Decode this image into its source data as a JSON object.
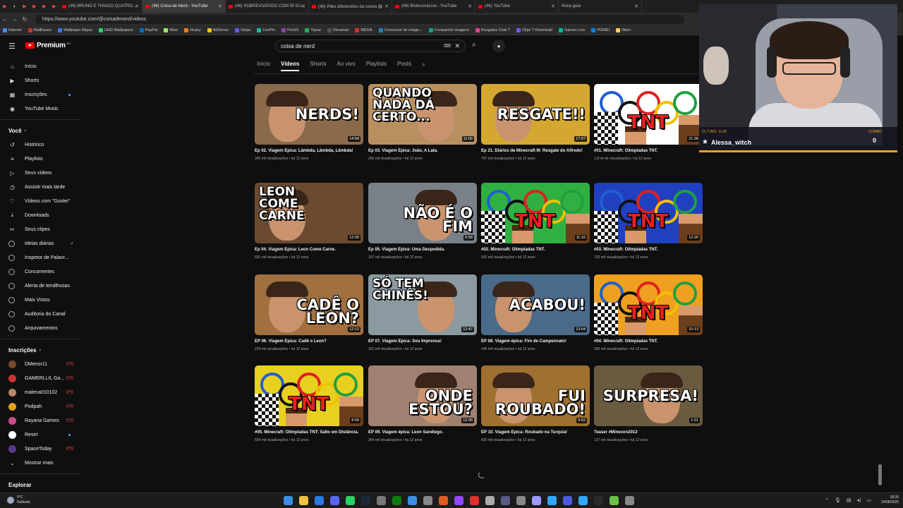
{
  "browser": {
    "tabs": [
      {
        "label": "(46) BRUNO E THIAGO QUATRO...",
        "active": false
      },
      {
        "label": "(46) Coisa de Nerd - YouTube",
        "active": true
      },
      {
        "label": "(46) SOBREVIVENDO COM 50 EU...",
        "active": false
      },
      {
        "label": "(46) Piles diferentões da coreia 😱",
        "active": false
      },
      {
        "label": "(46) BisteconeLive - YouTube",
        "active": false
      },
      {
        "label": "(46) YouTube",
        "active": false
      },
      {
        "label": "Nova guia",
        "active": false
      }
    ],
    "url": "https://www.youtube.com/@coisadenerd/videos",
    "bookmarks": [
      "Internet",
      "Wallhaven",
      "Wallpaper Abyss",
      "UHD Wallpapers",
      "PayPal",
      "Wise",
      "Husky",
      "AdSense",
      "Stripe",
      "LivePix",
      "PixGG",
      "Tipsai",
      "Streamar",
      "MEGA",
      "Conversor de image...",
      "Compactar imagens",
      "Resgates Chat T",
      "Clips T Download",
      "Games Live",
      "PGMEI",
      "Warn"
    ]
  },
  "masthead": {
    "logo_text": "Premium",
    "logo_region": "BR",
    "search_value": "coisa de nerd"
  },
  "channel_tabs": [
    "Início",
    "Vídeos",
    "Shorts",
    "Ao vivo",
    "Playlists",
    "Posts"
  ],
  "sidebar": {
    "main": [
      {
        "label": "Início",
        "icon": "home"
      },
      {
        "label": "Shorts",
        "icon": "shorts"
      },
      {
        "label": "Inscrições",
        "icon": "subscriptions",
        "dot": true
      },
      {
        "label": "YouTube Music",
        "icon": "music"
      }
    ],
    "you_heading": "Você",
    "you_items": [
      {
        "label": "Histórico",
        "icon": "history"
      },
      {
        "label": "Playlists",
        "icon": "playlists"
      },
      {
        "label": "Seus vídeos",
        "icon": "your-videos"
      },
      {
        "label": "Assistir mais tarde",
        "icon": "watch-later"
      },
      {
        "label": "Vídeos com \"Gostei\"",
        "icon": "liked"
      },
      {
        "label": "Downloads",
        "icon": "download"
      },
      {
        "label": "Seus clipes",
        "icon": "clips"
      }
    ],
    "ext_items": [
      "Ideias diárias",
      "Inspetor de Palavr...",
      "Concorrentes",
      "Alerta de tendências",
      "Mais Vistos",
      "Auditoria do Canal",
      "Arquivamentos"
    ],
    "subs_heading": "Inscrições",
    "subs": [
      {
        "label": "DMenor11",
        "color": "#7a4a2a",
        "status": "live"
      },
      {
        "label": "GAMERLLIL Ga...",
        "color": "#c83232",
        "status": "live"
      },
      {
        "label": "malena010102",
        "color": "#b58a6a",
        "status": "live"
      },
      {
        "label": "Podpah",
        "color": "#e0a020",
        "status": "live"
      },
      {
        "label": "Rayana Games",
        "color": "#d04a8a",
        "status": "live"
      },
      {
        "label": "Reset",
        "color": "#ffffff",
        "status": "dot"
      },
      {
        "label": "SpaceToday",
        "color": "#5a3a8a",
        "status": "live"
      }
    ],
    "show_more": "Mostrar mais",
    "explore_heading": "Explorar"
  },
  "videos": [
    {
      "title": "Ep 02. Viagem Épica: Lâmbda, Lâmbda, Lâmbda!",
      "meta": "345 mil visualizações • há 12 anos",
      "duration": "14:58",
      "thumb_text": "NERDS!",
      "bg": "#8a6a4a"
    },
    {
      "title": "Ep 03. Viagem Épica: João, A Lata.",
      "meta": "269 mil visualizações • há 12 anos",
      "duration": "11:09",
      "thumb_text": "QUANDO NADA DÁ CERTO...",
      "bg": "#b89060"
    },
    {
      "title": "Ep 21. Diários de Minecraft M: Resgate do Alfredo!",
      "meta": "747 mil visualizações • há 12 anos",
      "duration": "17:07",
      "thumb_text": "RESGATE!!",
      "bg": "#d4a830"
    },
    {
      "title": "#01. Minecraft: Olimpíadas TNT.",
      "meta": "1,8 mi de visualizações • há 12 anos",
      "duration": "21:36",
      "thumb_text": "TNT",
      "bg": "#ffffff"
    },
    {
      "title": "Ep 04. Viagem Épica: Leon Come Carne.",
      "meta": "691 mil visualizações • há 12 anos",
      "duration": "12:00",
      "thumb_text": "LEON COME CARNE",
      "bg": "#6a4a30"
    },
    {
      "title": "Ep 05. Viagem Épica: Uma Despedida.",
      "meta": "197 mil visualizações • há 12 anos",
      "duration": "6:58",
      "thumb_text": "NÃO É O FIM",
      "bg": "#7a8088"
    },
    {
      "title": "#02. Minecraft: Olimpíadas TNT.",
      "meta": "933 mil visualizações • há 12 anos",
      "duration": "11:16",
      "thumb_text": "TNT",
      "bg": "#30b040"
    },
    {
      "title": "#03. Minecraft: Olimpíadas TNT.",
      "meta": "720 mil visualizações • há 12 anos",
      "duration": "12:26",
      "thumb_text": "TNT",
      "bg": "#2040c0"
    },
    {
      "title": "EP 06. Viagem Épica: Cadê o Leon?",
      "meta": "224 mil visualizações • há 12 anos",
      "duration": "12:12",
      "thumb_text": "CADÊ O LEON?",
      "bg": "#a07040"
    },
    {
      "title": "EP 07. Viagem Épica: Sou Imprensa!",
      "meta": "162 mil visualizações • há 12 anos",
      "duration": "12:47",
      "thumb_text": "SÓ TEM CHINÊS!",
      "bg": "#8a9aa0"
    },
    {
      "title": "EP 08. Viagem épica: Fim de Campeonato!",
      "meta": "146 mil visualizações • há 12 anos",
      "duration": "13:04",
      "thumb_text": "ACABOU!",
      "bg": "#4a6a8a"
    },
    {
      "title": "#04. Minecraft: Olimpíadas TNT.",
      "meta": "596 mil visualizações • há 12 anos",
      "duration": "10:13",
      "thumb_text": "TNT",
      "bg": "#f0a020"
    },
    {
      "title": "#05. Minecraft: Olimpíadas TNT: Salto em Distância.",
      "meta": "554 mil visualizações • há 12 anos",
      "duration": "8:59",
      "thumb_text": "TNT",
      "bg": "#e8d020"
    },
    {
      "title": "EP 09. Viagem épica: Leon Sandiego.",
      "meta": "364 mil visualizações • há 12 anos",
      "duration": "12:36",
      "thumb_text": "ONDE ESTOU?",
      "bg": "#a08070"
    },
    {
      "title": "EP 10. Viagem Épica: Roubado na Turquia!",
      "meta": "425 mil visualizações • há 12 anos",
      "duration": "9:52",
      "thumb_text": "FUI ROUBADO!",
      "bg": "#a07030"
    },
    {
      "title": "Teaser #Minecon2012",
      "meta": "127 mil visualizações • há 12 anos",
      "duration": "1:21",
      "thumb_text": "SURPRESA!",
      "bg": "#6a5a40"
    }
  ],
  "overlay": {
    "last_sub_label": "ÚLTIMO SUB",
    "last_sub_name": "Alessa_witch",
    "count_label": "COMBO",
    "count_value": "0"
  },
  "taskbar": {
    "weather_temp": "9°C",
    "weather_desc": "Nublado",
    "time": "18:30",
    "date": "24/08/2025"
  }
}
